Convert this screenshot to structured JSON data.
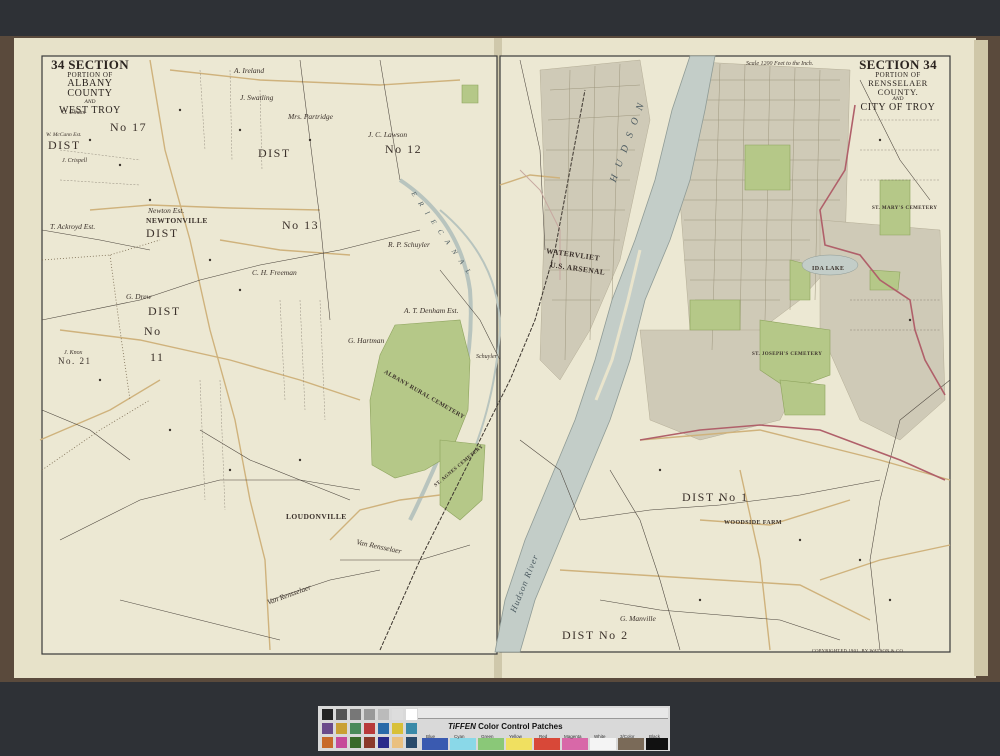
{
  "left_title": {
    "section": "34 SECTION",
    "portion": "PORTION OF",
    "county": "ALBANY COUNTY",
    "and": "AND",
    "place": "WEST TROY"
  },
  "right_title": {
    "section": "SECTION 34",
    "portion": "PORTION OF",
    "county": "RENSSELAER COUNTY.",
    "and": "AND",
    "place": "CITY OF TROY"
  },
  "scale_text": "Scale 1200 Feet to the Inch.",
  "copyright": "COPYRIGHTED 1901, BY WATSON & CO.",
  "districts": [
    {
      "id": "dist-no-17-a",
      "text": "DIST"
    },
    {
      "id": "dist-no-17-b",
      "text": "No 17"
    },
    {
      "id": "dist-no-12-a",
      "text": "DIST"
    },
    {
      "id": "dist-no-12-b",
      "text": "No 12"
    },
    {
      "id": "dist-no-13-a",
      "text": "DIST"
    },
    {
      "id": "dist-no-13-b",
      "text": "No 13"
    },
    {
      "id": "dist-no-11-a",
      "text": "DIST"
    },
    {
      "id": "dist-no-11-b",
      "text": "No"
    },
    {
      "id": "dist-no-11-c",
      "text": "11"
    },
    {
      "id": "dist-no-1",
      "text": "DIST No 1"
    },
    {
      "id": "dist-no-2",
      "text": "DIST No 2"
    },
    {
      "id": "dist-no-21",
      "text": "No. 21"
    }
  ],
  "places": [
    {
      "id": "newtonville",
      "text": "NEWTONVILLE"
    },
    {
      "id": "loudonville",
      "text": "LOUDONVILLE"
    },
    {
      "id": "watervliet",
      "text": "WATERVLIET"
    },
    {
      "id": "us-arsenal",
      "text": "U.S. ARSENAL"
    },
    {
      "id": "ida-lake",
      "text": "IDA LAKE"
    },
    {
      "id": "woodside-farm",
      "text": "WOODSIDE FARM"
    },
    {
      "id": "albany-rural-cemetery",
      "text": "ALBANY RURAL CEMETERY"
    },
    {
      "id": "st-agnes-cemetery",
      "text": "ST. AGNES CEMETERY"
    },
    {
      "id": "oakwood-cemetery",
      "text": "ST. JOSEPH'S CEMETERY"
    },
    {
      "id": "st-marys-cemetery",
      "text": "ST. MARY'S CEMETERY"
    }
  ],
  "owners": [
    {
      "id": "a-ireland",
      "text": "A. Ireland"
    },
    {
      "id": "j-swatling",
      "text": "J. Swatling"
    },
    {
      "id": "mrs-partridge",
      "text": "Mrs. Partridge"
    },
    {
      "id": "jc-lawson",
      "text": "J. C. Lawson"
    },
    {
      "id": "c-ulham",
      "text": "C. Ulham"
    },
    {
      "id": "w-mccann",
      "text": "W. McCann Est."
    },
    {
      "id": "j-crispell",
      "text": "J. Crispell"
    },
    {
      "id": "t-ackroyd",
      "text": "T. Ackroyd Est."
    },
    {
      "id": "g-drew",
      "text": "G. Drew"
    },
    {
      "id": "ch-freeman",
      "text": "C. H. Freeman"
    },
    {
      "id": "rp-schuyler",
      "text": "R. P. Schuyler"
    },
    {
      "id": "at-denham",
      "text": "A. T. Denham Est."
    },
    {
      "id": "g-hartman",
      "text": "G. Hartman"
    },
    {
      "id": "j-knox",
      "text": "J. Knox"
    },
    {
      "id": "newton-est",
      "text": "Newton Est."
    },
    {
      "id": "g-manville",
      "text": "G. Manville"
    },
    {
      "id": "van-rensselaer-1",
      "text": "Van Rensselaer"
    },
    {
      "id": "van-rensselaer-2",
      "text": "Van Rensselaer"
    },
    {
      "id": "schuyler",
      "text": "Schuyler"
    }
  ],
  "water": [
    {
      "id": "hudson-river-upper",
      "text": "H U D S O N"
    },
    {
      "id": "hudson-river-lower",
      "text": "Hudson River"
    },
    {
      "id": "erie-canal",
      "text": "E R I E   C A N A L"
    }
  ],
  "colorbar": {
    "brand": "TiFFEN",
    "brand_rest": "Color Control Patches",
    "swatch_names": [
      "Blue",
      "Cyan",
      "Green",
      "Yellow",
      "Red",
      "Magenta",
      "White",
      "3/Color",
      "Black"
    ],
    "colors": {
      "paper": "#ece8d3",
      "paper_dark": "#d9d2b6",
      "green": "#b7c98a",
      "green_dark": "#9db46c",
      "city_grey": "#c9c5b5",
      "river": "#c6d0cb",
      "road_line": "#cdb07a",
      "boundary_red": "#b0606a",
      "frame": "#3a3a3a"
    }
  }
}
